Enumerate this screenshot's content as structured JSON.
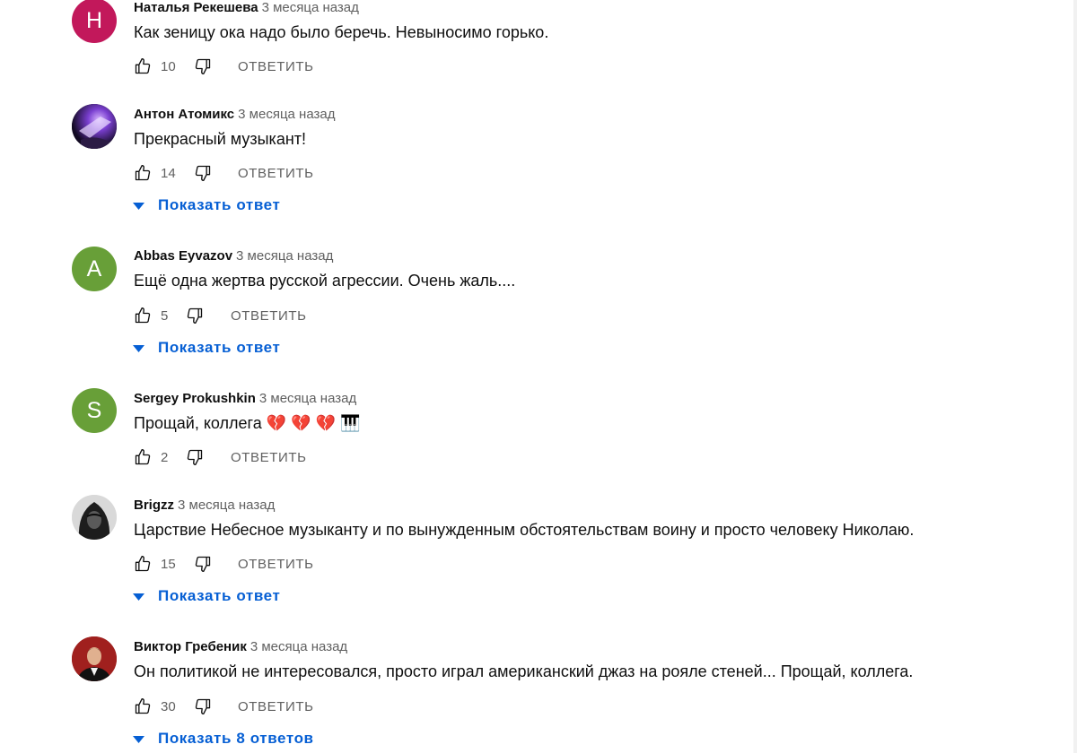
{
  "colors": {
    "link_blue": "#065fd4",
    "meta_gray": "#606060",
    "text": "#0f0f0f"
  },
  "comments": [
    {
      "author": "Наталья Рекешева",
      "time": "3 месяца назад",
      "text": "Как зеницу ока надо было беречь. Невыносимо горько.",
      "likes": "10",
      "reply_label": "ОТВЕТИТЬ",
      "avatar": {
        "type": "letter",
        "letter": "Н",
        "color": "#c2185b"
      }
    },
    {
      "author": "Антон Атомикс",
      "time": "3 месяца назад",
      "text": "Прекрасный музыкант!",
      "likes": "14",
      "reply_label": "ОТВЕТИТЬ",
      "show_replies": "Показать ответ",
      "avatar": {
        "type": "photo",
        "icon": "purple-light-photo"
      }
    },
    {
      "author": "Abbas Eyvazov",
      "time": "3 месяца назад",
      "text": "Ещё одна жертва русской агрессии. Очень жаль....",
      "likes": "5",
      "reply_label": "ОТВЕТИТЬ",
      "show_replies": "Показать ответ",
      "avatar": {
        "type": "letter",
        "letter": "A",
        "color": "#689f38"
      }
    },
    {
      "author": "Sergey Prokushkin",
      "time": "3 месяца назад",
      "text": "Прощай, коллега 💔 💔 💔 🎹",
      "likes": "2",
      "reply_label": "ОТВЕТИТЬ",
      "avatar": {
        "type": "letter",
        "letter": "S",
        "color": "#689f38"
      }
    },
    {
      "author": "Brigzz",
      "time": "3 месяца назад",
      "text": "Царствие Небесное музыканту и  по вынужденным  обстоятельствам воину и просто человеку Николаю.",
      "likes": "15",
      "reply_label": "ОТВЕТИТЬ",
      "show_replies": "Показать ответ",
      "avatar": {
        "type": "photo",
        "icon": "hooded-figure-photo"
      }
    },
    {
      "author": "Виктор Гребеник",
      "time": "3 месяца назад",
      "text": "Он политикой не интересовался, просто играл американский джаз на рояле стеней... Прощай, коллега.",
      "likes": "30",
      "reply_label": "ОТВЕТИТЬ",
      "show_replies": "Показать 8 ответов",
      "avatar": {
        "type": "photo",
        "icon": "man-in-suit-photo"
      }
    }
  ]
}
